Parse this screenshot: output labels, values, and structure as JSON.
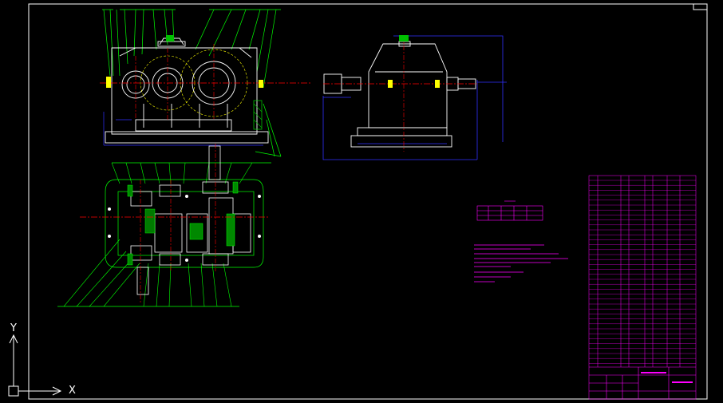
{
  "ucs": {
    "x_label": "X",
    "y_label": "Y"
  },
  "colors": {
    "background": "#000000",
    "frame": "#ffffff",
    "drawing_lines": "#ffffff",
    "dimension_lines": "#00ff00",
    "blue_dims": "#3030ff",
    "center_lines": "#ff0000",
    "yellow_lines": "#ffff00",
    "hatch": "#00c000",
    "notes_text": "#ff00ff",
    "title_block": "#ff00ff"
  }
}
